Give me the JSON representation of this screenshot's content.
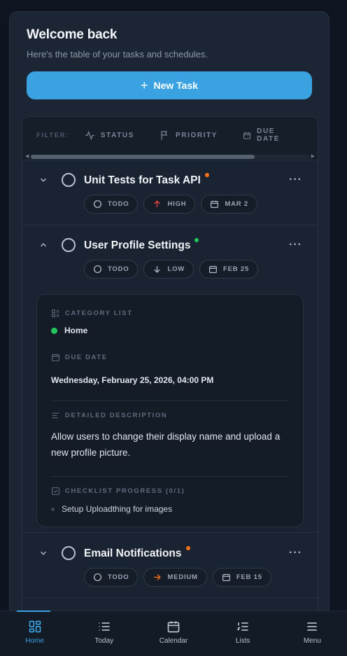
{
  "header": {
    "title": "Welcome back",
    "subtitle": "Here's the table of your tasks and schedules.",
    "new_task_label": "New Task"
  },
  "filters": {
    "label": "FILTER:",
    "items": [
      "STATUS",
      "PRIORITY",
      "DUE DATE"
    ]
  },
  "tasks": [
    {
      "title": "Unit Tests for Task API",
      "dot_color": "#f97316",
      "expanded": false,
      "status": "TODO",
      "priority": "HIGH",
      "due": "MAR 2"
    },
    {
      "title": "User Profile Settings",
      "dot_color": "#22c55e",
      "expanded": true,
      "status": "TODO",
      "priority": "LOW",
      "due": "FEB 25",
      "details": {
        "category_label": "CATEGORY LIST",
        "category": "Home",
        "due_label": "DUE DATE",
        "due_full": "Wednesday, February 25, 2026, 04:00 PM",
        "description_label": "DETAILED DESCRIPTION",
        "description": "Allow users to change their display name and upload a new profile picture.",
        "checklist_label": "CHECKLIST PROGRESS (0/1)",
        "checklist": [
          "Setup Uploadthing for images"
        ]
      }
    },
    {
      "title": "Email Notifications",
      "dot_color": "#f97316",
      "expanded": false,
      "status": "TODO",
      "priority": "MEDIUM",
      "due": "FEB 15"
    }
  ],
  "colors": {
    "accent": "#3aa2e0",
    "high": "#ef4444",
    "medium": "#f97316",
    "low": "#9aa5b4",
    "category_dot": "#22c55e"
  },
  "nav": {
    "items": [
      {
        "label": "Home",
        "icon": "home-grid-icon",
        "active": true
      },
      {
        "label": "Today",
        "icon": "list-icon",
        "active": false
      },
      {
        "label": "Calendar",
        "icon": "calendar-icon",
        "active": false
      },
      {
        "label": "Lists",
        "icon": "numbered-list-icon",
        "active": false
      },
      {
        "label": "Menu",
        "icon": "hamburger-icon",
        "active": false
      }
    ]
  }
}
